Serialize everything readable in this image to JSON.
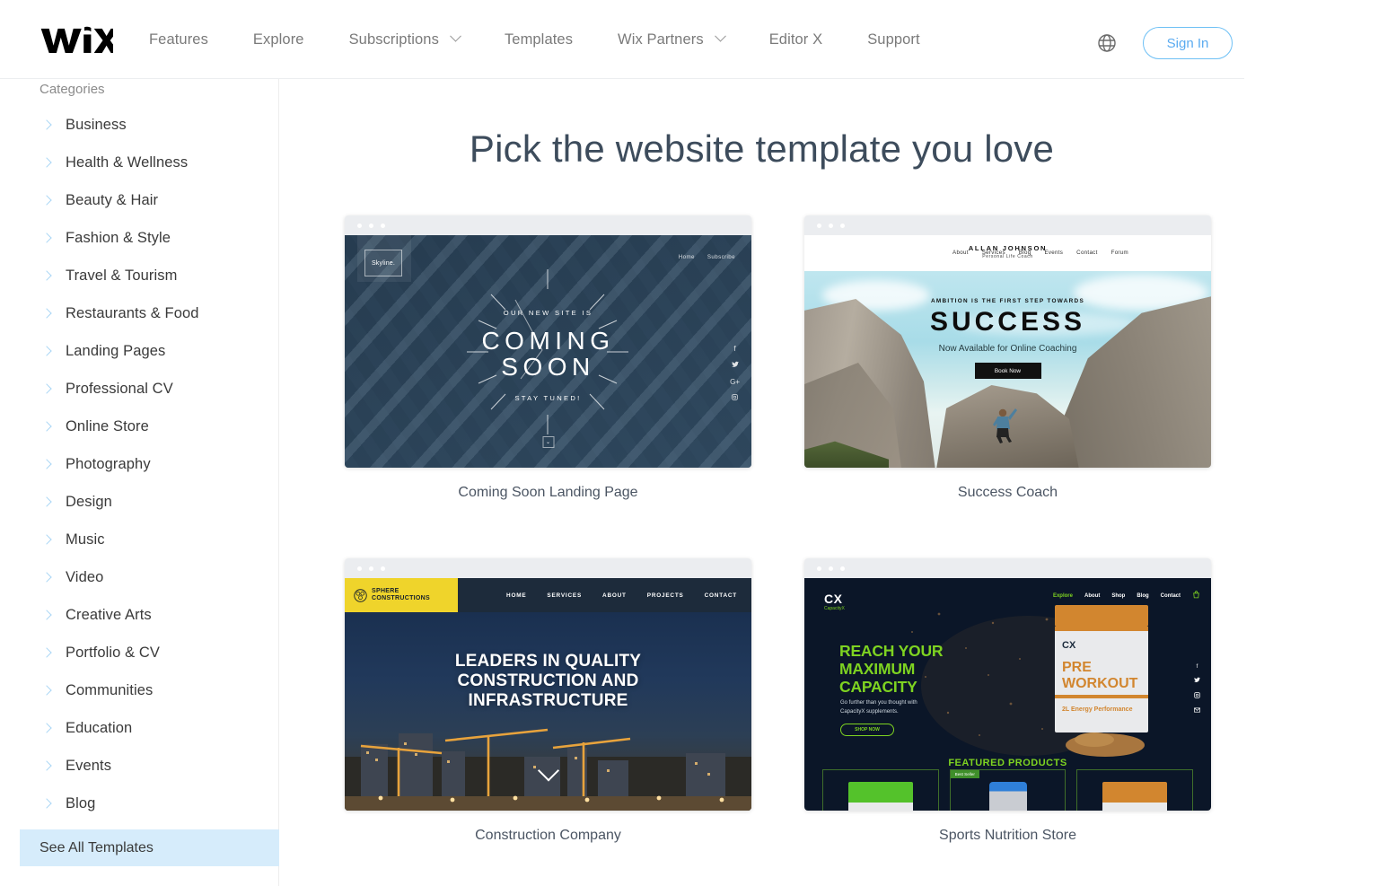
{
  "header": {
    "logo_text": "WiX",
    "nav": [
      {
        "label": "Features",
        "has_caret": false
      },
      {
        "label": "Explore",
        "has_caret": false
      },
      {
        "label": "Subscriptions",
        "has_caret": true
      },
      {
        "label": "Templates",
        "has_caret": false
      },
      {
        "label": "Wix Partners",
        "has_caret": true
      },
      {
        "label": "Editor X",
        "has_caret": false
      },
      {
        "label": "Support",
        "has_caret": false
      }
    ],
    "language_icon": "globe-icon",
    "signin_label": "Sign In",
    "signin_color": "#5babf0"
  },
  "sidebar": {
    "title": "Categories",
    "items": [
      {
        "label": "Business"
      },
      {
        "label": "Health & Wellness"
      },
      {
        "label": "Beauty & Hair"
      },
      {
        "label": "Fashion & Style"
      },
      {
        "label": "Travel & Tourism"
      },
      {
        "label": "Restaurants & Food"
      },
      {
        "label": "Landing Pages"
      },
      {
        "label": "Professional CV"
      },
      {
        "label": "Online Store"
      },
      {
        "label": "Photography"
      },
      {
        "label": "Design"
      },
      {
        "label": "Music"
      },
      {
        "label": "Video"
      },
      {
        "label": "Creative Arts"
      },
      {
        "label": "Portfolio & CV"
      },
      {
        "label": "Communities"
      },
      {
        "label": "Education"
      },
      {
        "label": "Events"
      },
      {
        "label": "Blog"
      }
    ],
    "see_all_label": "See All Templates",
    "see_all_highlight": "#d6ecfb",
    "chevron_color": "#a9d6f5"
  },
  "main": {
    "page_title": "Pick the website template you love",
    "templates": [
      {
        "caption": "Coming Soon Landing Page",
        "preview": {
          "logo": "Skyline.",
          "nav": [
            "Home",
            "Subscribe"
          ],
          "pre_text": "OUR NEW SITE IS",
          "headline_line1": "COMING",
          "headline_line2": "SOON",
          "post_text": "STAY TUNED!",
          "social": [
            "f",
            "t",
            "G+",
            "▣"
          ],
          "bg_color": "#2d465c"
        }
      },
      {
        "caption": "Success Coach",
        "preview": {
          "brand": "ALLAN JOHNSON",
          "brand_sub": "Personal Life Coach",
          "nav": [
            "About",
            "Services",
            "Blog",
            "Events",
            "Contact",
            "Forum"
          ],
          "pre_text": "AMBITION IS THE FIRST STEP TOWARDS",
          "headline": "SUCCESS",
          "subhead": "Now Available for Online Coaching",
          "button": "Book Now",
          "bg_color": "#a8dce8"
        }
      },
      {
        "caption": "Construction Company",
        "preview": {
          "logo_line1": "SPHERE",
          "logo_line2": "CONSTRUCTIONS",
          "logo_bg": "#efd42b",
          "nav": [
            "HOME",
            "SERVICES",
            "ABOUT",
            "PROJECTS",
            "CONTACT"
          ],
          "headline_line1": "LEADERS IN QUALITY",
          "headline_line2": "CONSTRUCTION AND",
          "headline_line3": "INFRASTRUCTURE",
          "scroll_icon": "chevron-down-icon",
          "bg_color": "#21395b"
        }
      },
      {
        "caption": "Sports Nutrition Store",
        "preview": {
          "logo": "CX",
          "logo_sub": "CapacityX",
          "nav": [
            "Explore",
            "About",
            "Shop",
            "Blog",
            "Contact"
          ],
          "nav_active": "Explore",
          "cart_icon": "cart-icon",
          "headline_line1": "REACH YOUR",
          "headline_line2": "MAXIMUM",
          "headline_line3": "CAPACITY",
          "body": "Go further than you thought with CapacityX supplements.",
          "button": "SHOP NOW",
          "section_title": "FEATURED PRODUCTS",
          "pack_brand": "CX",
          "pack_line1": "PRE",
          "pack_line2": "WORKOUT",
          "pack_tags": "2L   Energy   Performance",
          "badge": "Best Seller",
          "social": [
            "f",
            "t",
            "▣",
            "✉"
          ],
          "accent_color": "#7ed321",
          "bg_color": "#0b1628"
        }
      }
    ]
  }
}
